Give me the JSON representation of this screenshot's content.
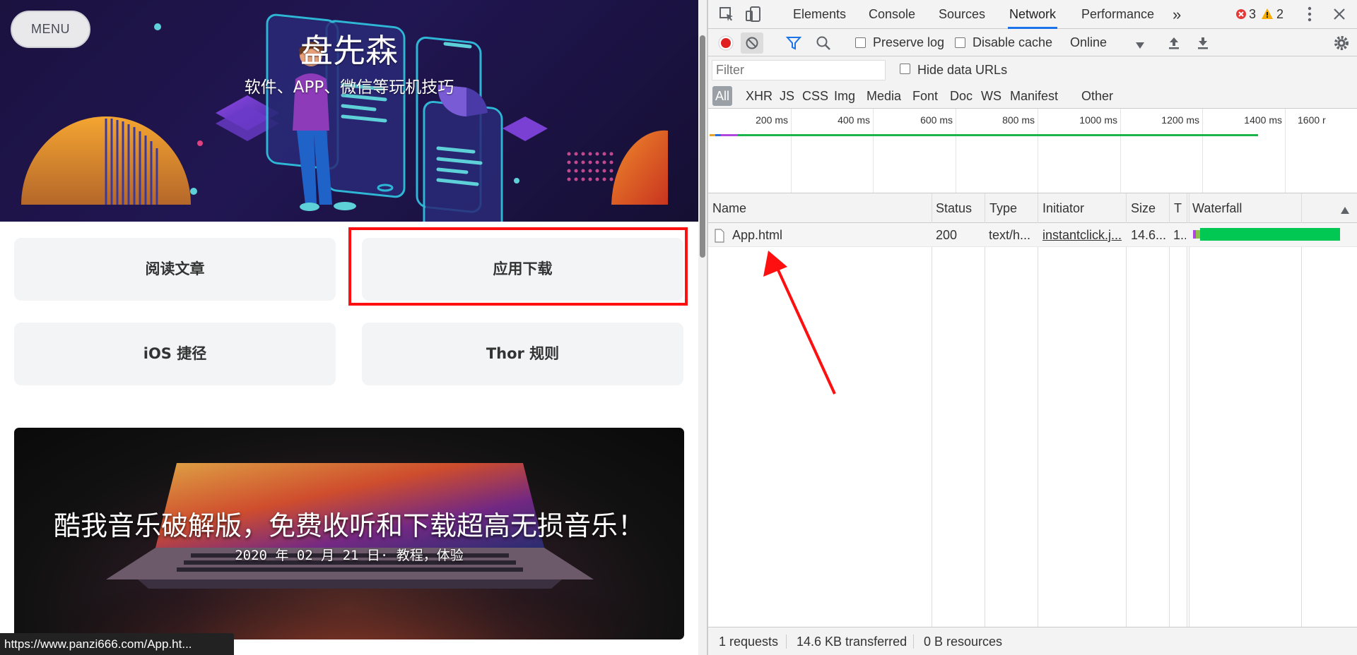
{
  "site": {
    "menu_label": "MENU",
    "title": "盘先森",
    "subtitle": "软件、APP、微信等玩机技巧",
    "tiles": [
      "阅读文章",
      "应用下载",
      "iOS 捷径",
      "Thor 规则"
    ],
    "article": {
      "title": "酷我音乐破解版，免费收听和下载超高无损音乐！",
      "meta": "2020 年 02 月 21 日· 教程，体验"
    },
    "status_url": "https://www.panzi666.com/App.ht..."
  },
  "devtools": {
    "tabs": [
      "Elements",
      "Console",
      "Sources",
      "Network",
      "Performance"
    ],
    "active_tab": "Network",
    "more_tabs_icon": "»",
    "error_count": "3",
    "warning_count": "2",
    "toolbar": {
      "preserve_log": "Preserve log",
      "disable_cache": "Disable cache",
      "throttling": "Online"
    },
    "filter": {
      "placeholder": "Filter",
      "hide_data_urls": "Hide data URLs",
      "types": [
        "All",
        "XHR",
        "JS",
        "CSS",
        "Img",
        "Media",
        "Font",
        "Doc",
        "WS",
        "Manifest",
        "Other"
      ]
    },
    "timeline_ticks": [
      "200 ms",
      "400 ms",
      "600 ms",
      "800 ms",
      "1000 ms",
      "1200 ms",
      "1400 ms",
      "1600 r"
    ],
    "columns": [
      "Name",
      "Status",
      "Type",
      "Initiator",
      "Size",
      "T",
      "Waterfall"
    ],
    "rows": [
      {
        "name": "App.html",
        "status": "200",
        "type": "text/h...",
        "initiator": "instantclick.j...",
        "size": "14.6...",
        "time": "1..."
      }
    ],
    "footer": {
      "requests": "1 requests",
      "transferred": "14.6 KB transferred",
      "resources": "0 B resources"
    }
  },
  "colors": {
    "highlight": "#ff1010",
    "accent": "#1a73e8",
    "waterfall": "#00c853",
    "record": "#e02020"
  }
}
